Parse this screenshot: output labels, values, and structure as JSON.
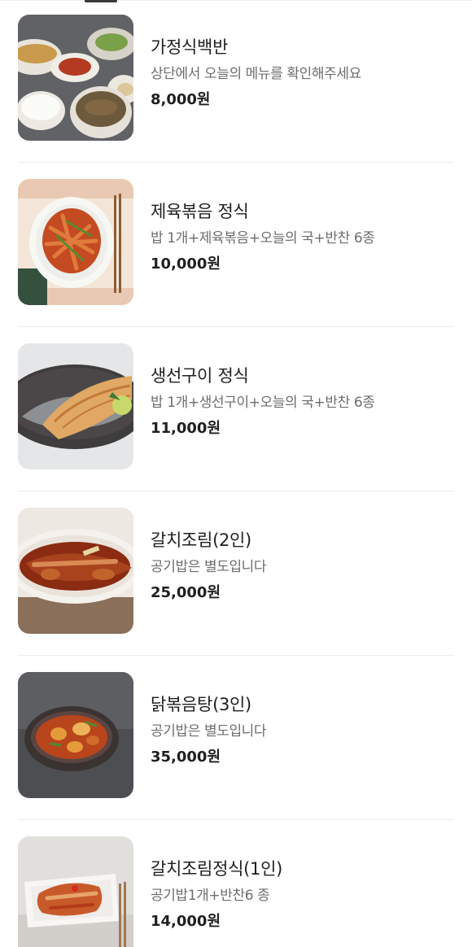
{
  "menu": {
    "items": [
      {
        "name": "가정식백반",
        "description": "상단에서 오늘의 메뉴를 확인해주세요",
        "price": "8,000원"
      },
      {
        "name": "제육볶음 정식",
        "description": "밥 1개+제육볶음+오늘의 국+반찬 6종",
        "price": "10,000원"
      },
      {
        "name": "생선구이 정식",
        "description": "밥 1개+생선구이+오늘의 국+반찬 6종",
        "price": "11,000원"
      },
      {
        "name": "갈치조림(2인)",
        "description": "공기밥은 별도입니다",
        "price": "25,000원"
      },
      {
        "name": "닭볶음탕(3인)",
        "description": "공기밥은 별도입니다",
        "price": "35,000원"
      },
      {
        "name": "갈치조림정식(1인)",
        "description": "공기밥1개+반찬6 종",
        "price": "14,000원"
      }
    ]
  },
  "colors": {
    "text_primary": "#1f1f1f",
    "text_secondary": "#6d6d6d",
    "divider": "#ececec"
  }
}
